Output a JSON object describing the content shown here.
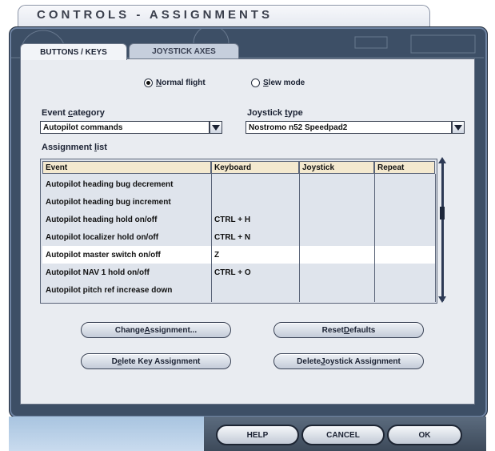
{
  "window": {
    "title": "CONTROLS - ASSIGNMENTS"
  },
  "tabs": [
    {
      "label": "BUTTONS / KEYS",
      "active": true
    },
    {
      "label": "JOYSTICK AXES",
      "active": false
    }
  ],
  "mode": {
    "normal": {
      "pre": "",
      "accel": "N",
      "post": "ormal flight",
      "selected": true
    },
    "slew": {
      "pre": "",
      "accel": "S",
      "post": "lew mode",
      "selected": false
    }
  },
  "event_category": {
    "label_pre": "Event ",
    "label_accel": "c",
    "label_post": "ategory",
    "value": "Autopilot commands"
  },
  "joystick_type": {
    "label_pre": "Joystick ",
    "label_accel": "t",
    "label_post": "ype",
    "value": "Nostromo n52 Speedpad2"
  },
  "assignment_list": {
    "label_pre": "Assignment ",
    "label_accel": "l",
    "label_post": "ist",
    "columns": [
      "Event",
      "Keyboard",
      "Joystick",
      "Repeat"
    ],
    "rows": [
      {
        "event": "Autopilot heading bug decrement",
        "keyboard": "",
        "joystick": "",
        "repeat": ""
      },
      {
        "event": "Autopilot heading bug increment",
        "keyboard": "",
        "joystick": "",
        "repeat": ""
      },
      {
        "event": "Autopilot heading hold on/off",
        "keyboard": "CTRL + H",
        "joystick": "",
        "repeat": ""
      },
      {
        "event": "Autopilot localizer hold on/off",
        "keyboard": "CTRL + N",
        "joystick": "",
        "repeat": ""
      },
      {
        "event": "Autopilot master switch on/off",
        "keyboard": "Z",
        "joystick": "",
        "repeat": ""
      },
      {
        "event": "Autopilot NAV 1 hold on/off",
        "keyboard": "CTRL + O",
        "joystick": "",
        "repeat": ""
      },
      {
        "event": "Autopilot pitch ref increase down",
        "keyboard": "",
        "joystick": "",
        "repeat": ""
      }
    ],
    "selected_row": 4
  },
  "buttons": {
    "change": {
      "pre": "Change ",
      "accel": "A",
      "post": "ssignment..."
    },
    "reset": {
      "pre": "Reset ",
      "accel": "D",
      "post": "efaults"
    },
    "delete_key": {
      "pre": "D",
      "accel": "e",
      "post": "lete Key Assignment"
    },
    "delete_joy": {
      "pre": "Delete ",
      "accel": "J",
      "post": "oystick Assignment"
    }
  },
  "footer": {
    "help": "HELP",
    "cancel": "CANCEL",
    "ok": "OK"
  },
  "colors": {
    "frame": "#3d4f66",
    "panel": "#e9ecf1",
    "header_cell": "#f4e9cf",
    "selected_row": "#ffffff"
  }
}
